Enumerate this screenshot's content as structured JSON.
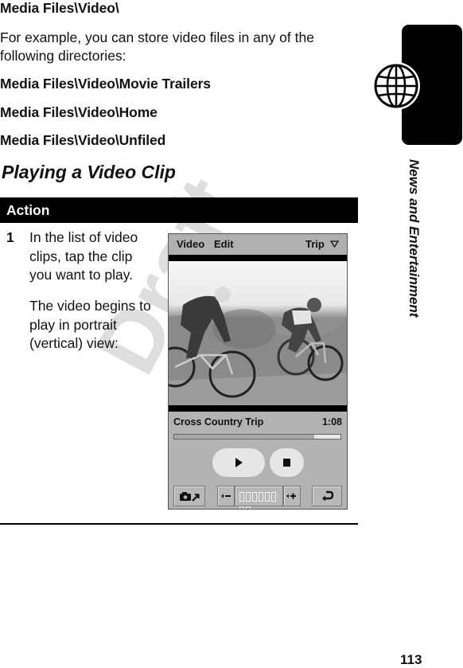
{
  "intro": {
    "path_heading": "Media Files\\Video\\",
    "paragraph": "For example, you can store video files in any of the following directories:",
    "directories": [
      "Media Files\\Video\\Movie Trailers",
      "Media Files\\Video\\Home",
      "Media Files\\Video\\Unfiled"
    ]
  },
  "section": {
    "title": "Playing a Video Clip"
  },
  "action_table": {
    "header": "Action",
    "steps": [
      {
        "number": "1",
        "text": "In the list of video clips, tap the clip you want to play.",
        "note": "The video begins to play in portrait (vertical) view:"
      }
    ]
  },
  "device_screen": {
    "menu": [
      "Video",
      "Edit"
    ],
    "category_dropdown": "Trip",
    "clip_title": "Cross Country Trip",
    "clip_time": "1:08",
    "playback_progress_percent": 84,
    "volume_segments_total": 8,
    "video_description": "Two mountain bikers riding on a dirt trail",
    "buttons": [
      "play",
      "stop",
      "capture",
      "volume-down",
      "volume-up",
      "back"
    ]
  },
  "side_tab": {
    "label": "News and Entertainment",
    "icon": "globe-icon"
  },
  "watermark": "Draft",
  "page_number": "113"
}
